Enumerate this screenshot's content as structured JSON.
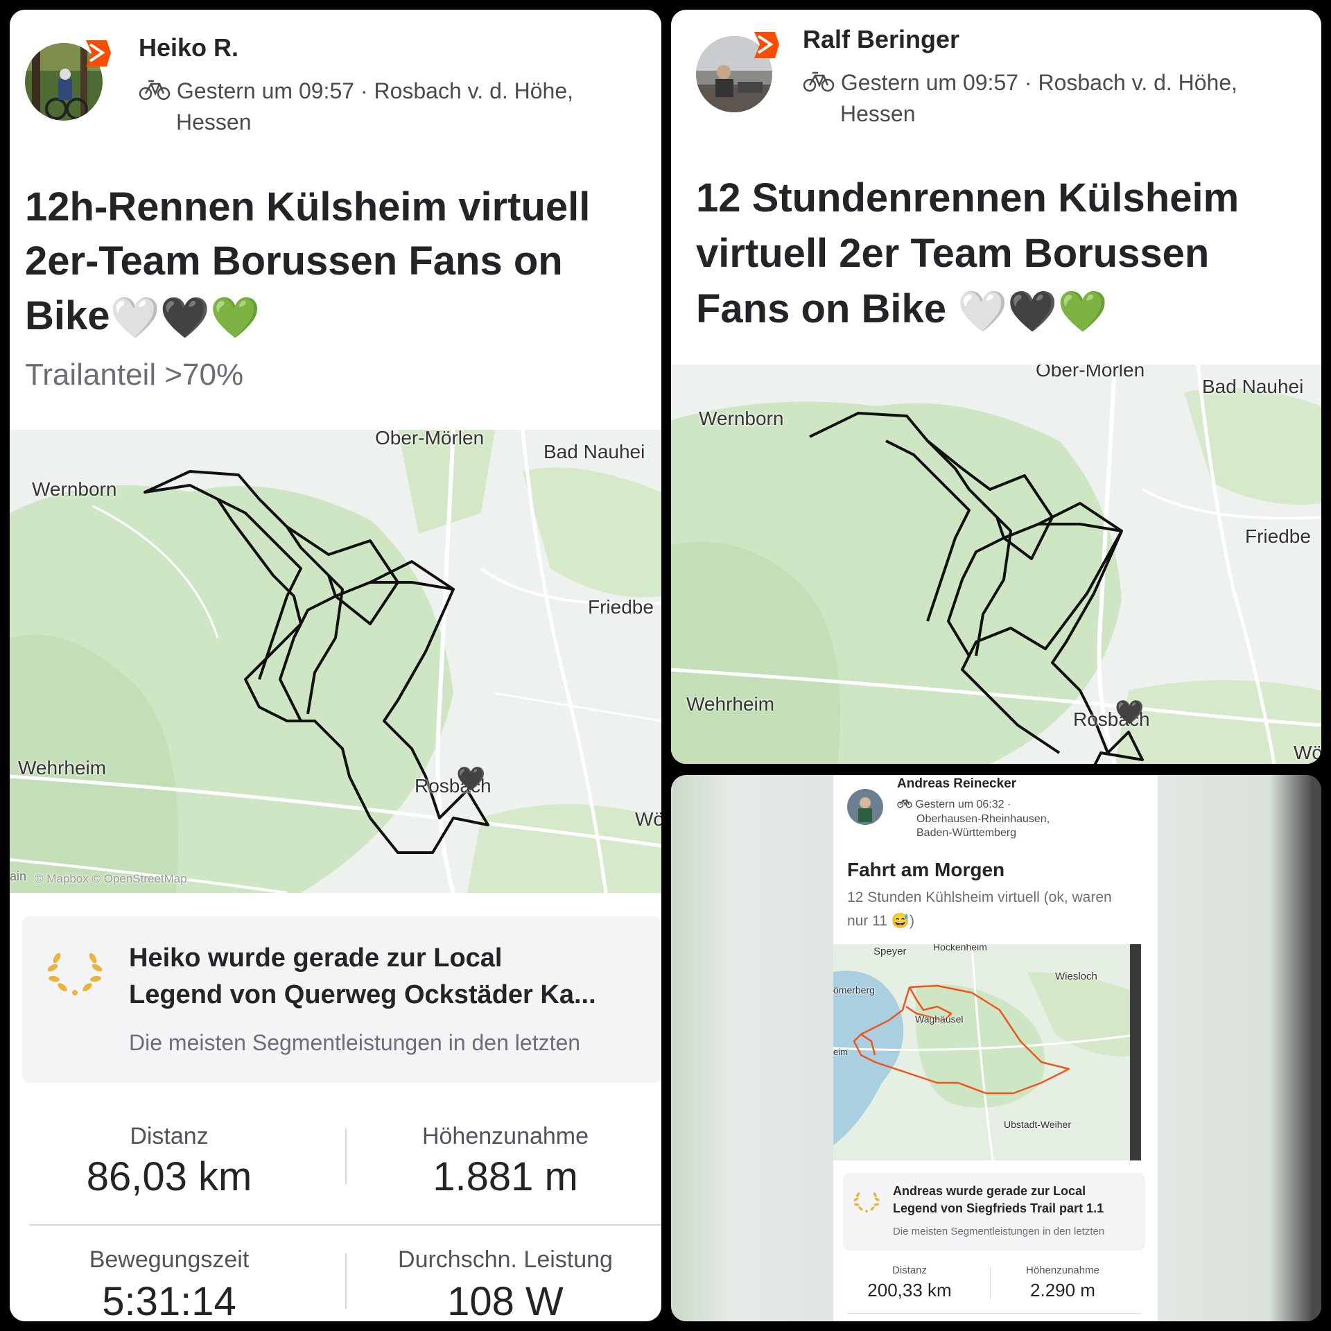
{
  "post1": {
    "athlete": "Heiko R.",
    "time": "Gestern um 09:57 · Rosbach v. d. Höhe,",
    "location_line2": "Hessen",
    "title_line1": "12h-Rennen Külsheim virtuell",
    "title_line2": "2er-Team Borussen Fans on",
    "title_line3": "Bike",
    "hearts": [
      "🤍",
      "🖤",
      "💚"
    ],
    "description": "Trailanteil >70%",
    "map_labels": {
      "ober_moerlen": "Ober-Mörlen",
      "bad_nauheim": "Bad Nauhei",
      "wernborn": "Wernborn",
      "friedberg": "Friedbe",
      "wehrheim": "Wehrheim",
      "rosbach": "Rosbach",
      "woe": "Wö",
      "attribution": "© Mapbox © OpenStreetMap",
      "edge": "ain"
    },
    "legend_title_line1": "Heiko wurde gerade zur Local",
    "legend_title_line2": "Legend von Querweg Ockstäder Ka...",
    "legend_desc": "Die meisten Segmentleistungen in den letzten",
    "stats": {
      "distance_label": "Distanz",
      "distance_value": "86,03 km",
      "elevation_label": "Höhenzunahme",
      "elevation_value": "1.881 m",
      "moving_label": "Bewegungszeit",
      "moving_value": "5:31:14",
      "power_label": "Durchschn. Leistung",
      "power_value": "108 W"
    }
  },
  "post2": {
    "athlete": "Ralf Beringer",
    "time": "Gestern um 09:57 · Rosbach v. d. Höhe,",
    "location_line2": "Hessen",
    "title_line1": "12 Stundenrennen Külsheim",
    "title_line2": "virtuell 2er Team Borussen",
    "title_line3": "Fans on Bike",
    "hearts": [
      "🤍",
      "🖤",
      "💚"
    ],
    "map_labels": {
      "ober_moerlen": "Ober-Mörlen",
      "bad_nauheim": "Bad Nauhei",
      "wernborn": "Wernborn",
      "friedberg": "Friedbe",
      "wehrheim": "Wehrheim",
      "rosbach": "Rosbach",
      "woe": "Wö"
    }
  },
  "post3": {
    "athlete": "Andreas Reinecker",
    "time": "Gestern um 06:32 ·",
    "location_line2": "Oberhausen-Rheinhausen,",
    "location_line3": "Baden-Württemberg",
    "title": "Fahrt am Morgen",
    "description_line1": "12 Stunden Kühlsheim virtuell (ok, waren",
    "description_line2": "nur 11 😅)",
    "map_labels": {
      "speyer": "Speyer",
      "hockenheim": "Hockenheim",
      "roemerberg": "ömerberg",
      "wiesloch": "Wiesloch",
      "waghaeusel": "Waghäusel",
      "eim": "eim",
      "ubstadt": "Ubstadt-Weiher"
    },
    "legend_title_line1": "Andreas wurde gerade zur Local",
    "legend_title_line2": "Legend von Siegfrieds Trail part 1.1",
    "legend_desc": "Die meisten Segmentleistungen in den letzten",
    "stats": {
      "distance_label": "Distanz",
      "distance_value": "200,33 km",
      "elevation_label": "Höhenzunahme",
      "elevation_value": "2.290 m"
    }
  },
  "colors": {
    "strava_orange": "#fc4c02",
    "route_black": "#111111",
    "route_orange": "#f0541c",
    "map_green": "#cfe6c4",
    "map_bg": "#eef2ee",
    "laurel_gold": "#e8b43a"
  }
}
